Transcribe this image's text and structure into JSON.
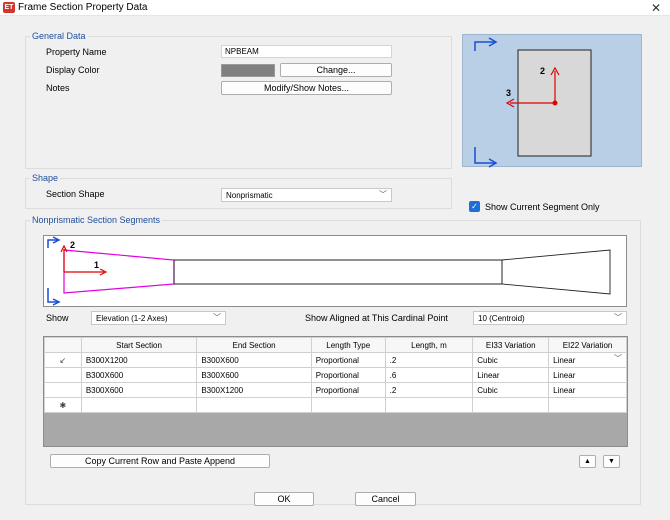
{
  "window": {
    "title": "Frame Section Property Data",
    "icon_text": "ET",
    "close_glyph": "✕"
  },
  "general_data": {
    "legend": "General Data",
    "property_name_label": "Property Name",
    "property_name_value": "NPBEAM",
    "display_color_label": "Display Color",
    "display_color_swatch": "#808080",
    "change_button": "Change...",
    "notes_label": "Notes",
    "notes_button": "Modify/Show Notes..."
  },
  "preview": {
    "axis_2": "2",
    "axis_3": "3"
  },
  "shape": {
    "legend": "Shape",
    "section_shape_label": "Section Shape",
    "section_shape_value": "Nonprismatic"
  },
  "show_current_segment_only": {
    "label": "Show Current Segment Only",
    "checked": true
  },
  "segments": {
    "legend": "Nonprismatic Section Segments",
    "canvas_axis_2": "2",
    "canvas_axis_1": "1",
    "show_label": "Show",
    "show_value": "Elevation (1-2 Axes)",
    "aligned_label": "Show Aligned at This Cardinal Point",
    "aligned_value": "10  (Centroid)",
    "columns": [
      "Start Section",
      "End Section",
      "Length Type",
      "Length, m",
      "EI33 Variation",
      "EI22 Variation"
    ],
    "rows": [
      {
        "marker": "↙",
        "cells": [
          "B300X1200",
          "B300X600",
          "Proportional",
          ".2",
          "Cubic",
          "Linear"
        ]
      },
      {
        "marker": "",
        "cells": [
          "B300X600",
          "B300X600",
          "Proportional",
          ".6",
          "Linear",
          "Linear"
        ]
      },
      {
        "marker": "",
        "cells": [
          "B300X600",
          "B300X1200",
          "Proportional",
          ".2",
          "Cubic",
          "Linear"
        ]
      }
    ],
    "new_row_marker": "✱",
    "copy_button": "Copy Current Row and Paste Append",
    "move_up_glyph": "▲",
    "move_down_glyph": "▼"
  },
  "footer": {
    "ok": "OK",
    "cancel": "Cancel"
  }
}
